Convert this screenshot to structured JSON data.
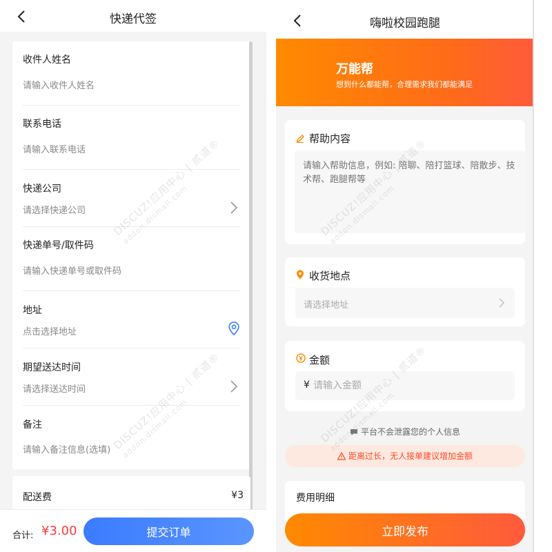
{
  "left": {
    "title": "快递代签",
    "fields": [
      {
        "label": "收件人姓名",
        "value": "请输入收件人姓名"
      },
      {
        "label": "联系电话",
        "value": "请输入联系电话"
      },
      {
        "label": "快递公司",
        "value": "请选择快递公司"
      },
      {
        "label": "快递单号/取件码",
        "value": "请输入快递单号或取件码"
      },
      {
        "label": "地址",
        "value": "点击选择地址"
      },
      {
        "label": "期望送达时间",
        "value": "请选择送达时间"
      },
      {
        "label": "备注",
        "value": "请输入备注信息(选填)"
      }
    ],
    "fee_label": "配送费",
    "fee_value": "¥3",
    "total_label": "合计:",
    "total_value": "¥3.00",
    "submit_label": "提交订单"
  },
  "right": {
    "title": "嗨啦校园跑腿",
    "banner_title": "万能帮",
    "banner_subtitle": "想到什么都能帮，合理需求我们都能满足",
    "help_title": "帮助内容",
    "help_placeholder": "请输入帮助信息，例如: 陪聊、陪打篮球、陪散步、技术帮、跑腿帮等",
    "address_title": "收货地点",
    "address_placeholder": "请选择地址",
    "amount_title": "金额",
    "amount_currency": "¥",
    "amount_placeholder": "请输入金额",
    "privacy_text": "平台不会泄露您的个人信息",
    "notice_text": "距离过长，无人接单建议增加金额",
    "fee_detail_title": "费用明细",
    "publish_label": "立即发布"
  },
  "watermark": {
    "main": "DISCUZ!应用中心 | 贰道®",
    "sub": "addon.dismall.com"
  },
  "colors": {
    "accent_blue": "#3b7bff",
    "accent_orange": "#ff8a00",
    "price_red": "#ff3b3b",
    "notice_red": "#ff4a2a"
  }
}
